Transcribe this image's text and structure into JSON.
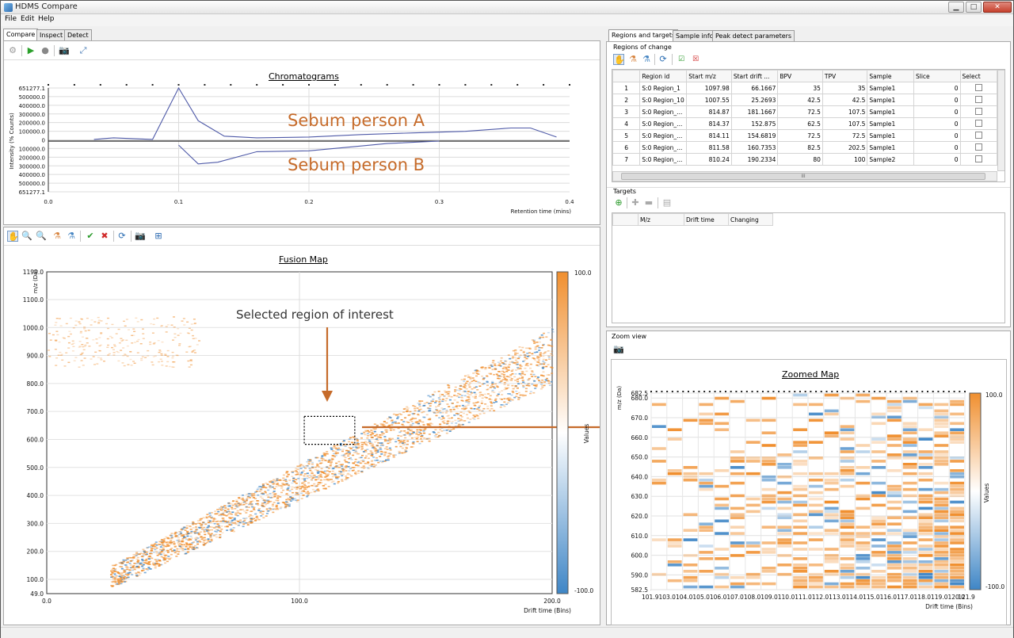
{
  "window": {
    "title": "HDMS Compare",
    "minimize": "▁",
    "maximize": "□",
    "close": "✕"
  },
  "menu": [
    "File",
    "Edit",
    "Help"
  ],
  "left_tabs": [
    "Compare",
    "Inspect",
    "Detect"
  ],
  "right_tabs": [
    "Regions and targets",
    "Sample info",
    "Peak detect parameters"
  ],
  "chromatogram": {
    "title": "Chromatograms",
    "ylabel": "Intensity (% Counts)",
    "xlabel": "Retention time (mins)",
    "y_ticks": [
      "651277.1",
      "500000.0",
      "400000.0",
      "300000.0",
      "200000.0",
      "100000.0",
      "0",
      "100000.0",
      "200000.0",
      "300000.0",
      "400000.0",
      "500000.0",
      "651277.1"
    ],
    "x_ticks": [
      "0.0",
      "0.1",
      "0.2",
      "0.3",
      "0.4"
    ],
    "label_a": "Sebum person A",
    "label_b": "Sebum person B"
  },
  "chart_data": [
    {
      "type": "line",
      "title": "Chromatograms",
      "xlabel": "Retention time (mins)",
      "ylabel": "Intensity (% Counts)",
      "xlim": [
        0.0,
        0.4
      ],
      "ylim": [
        -651277.1,
        651277.1
      ],
      "series": [
        {
          "name": "Sebum person A",
          "x": [
            0.035,
            0.05,
            0.065,
            0.08,
            0.1,
            0.115,
            0.135,
            0.16,
            0.2,
            0.24,
            0.28,
            0.32,
            0.355,
            0.37,
            0.39
          ],
          "y": [
            20000,
            40000,
            30000,
            20000,
            651277,
            250000,
            60000,
            40000,
            50000,
            80000,
            100000,
            120000,
            160000,
            160000,
            50000
          ]
        },
        {
          "name": "Sebum person B",
          "x": [
            0.1,
            0.115,
            0.13,
            0.16,
            0.2,
            0.24,
            0.26,
            0.3
          ],
          "y": [
            -50000,
            -280000,
            -260000,
            -130000,
            -120000,
            -60000,
            -30000,
            0
          ]
        }
      ]
    },
    {
      "type": "heatmap",
      "title": "Fusion Map",
      "xlabel": "Drift time (Bins)",
      "ylabel": "m/z (Da)",
      "xlim": [
        0,
        200
      ],
      "ylim": [
        49,
        1199
      ],
      "colorbar": {
        "label": "Values",
        "min": -100,
        "max": 100
      }
    },
    {
      "type": "heatmap",
      "title": "Zoomed Map",
      "xlabel": "Drift time (Bins)",
      "ylabel": "m/z (Da)",
      "xlim": [
        101.9,
        121.9
      ],
      "ylim": [
        582.5,
        682.5
      ],
      "colorbar": {
        "label": "Values",
        "min": -100,
        "max": 100
      }
    }
  ],
  "fusion_map": {
    "title": "Fusion Map",
    "ylabel": "m/z (Da)",
    "xlabel": "Drift time (Bins)",
    "y_ticks": [
      "1199.0",
      "1100.0",
      "1000.0",
      "900.0",
      "800.0",
      "700.0",
      "600.0",
      "500.0",
      "400.0",
      "300.0",
      "200.0",
      "100.0",
      "49.0"
    ],
    "x_ticks": [
      "0.0",
      "100.0",
      "200.0"
    ],
    "colorbar_max": "100.0",
    "colorbar_min": "-100.0",
    "colorbar_label": "Values",
    "annotation": "Selected region of interest"
  },
  "regions": {
    "section_title": "Regions of change",
    "columns": [
      "",
      "Region id",
      "Start m/z",
      "Start drift ...",
      "BPV",
      "TPV",
      "Sample",
      "Slice",
      "Select"
    ],
    "rows": [
      [
        "1",
        "S:0 Region_1",
        "1097.98",
        "66.1667",
        "35",
        "35",
        "Sample1",
        "0"
      ],
      [
        "2",
        "S:0 Region_10",
        "1007.55",
        "25.2693",
        "42.5",
        "42.5",
        "Sample1",
        "0"
      ],
      [
        "3",
        "S:0 Region_...",
        "814.87",
        "181.1667",
        "72.5",
        "107.5",
        "Sample1",
        "0"
      ],
      [
        "4",
        "S:0 Region_...",
        "814.37",
        "152.875",
        "62.5",
        "107.5",
        "Sample1",
        "0"
      ],
      [
        "5",
        "S:0 Region_...",
        "814.11",
        "154.6819",
        "72.5",
        "72.5",
        "Sample1",
        "0"
      ],
      [
        "6",
        "S:0 Region_...",
        "811.58",
        "160.7353",
        "82.5",
        "202.5",
        "Sample1",
        "0"
      ],
      [
        "7",
        "S:0 Region_...",
        "810.24",
        "190.2334",
        "80",
        "100",
        "Sample2",
        "0"
      ]
    ],
    "hscroll_marker": "III"
  },
  "targets": {
    "section_title": "Targets",
    "columns": [
      "",
      "M/z",
      "Drift time",
      "Changing"
    ]
  },
  "zoom": {
    "section_title": "Zoom view",
    "title": "Zoomed Map",
    "ylabel": "m/z (Da)",
    "xlabel": "Drift time (Bins)",
    "y_ticks": [
      "682.5",
      "680.0",
      "670.0",
      "660.0",
      "650.0",
      "640.0",
      "630.0",
      "620.0",
      "610.0",
      "600.0",
      "590.0",
      "582.5"
    ],
    "x_ticks": "101.9103.0104.0105.0106.0107.0108.0109.0110.0111.0112.0113.0114.0115.0116.0117.0118.0119.0120.0",
    "x_end": "121.9",
    "colorbar_max": "100.0",
    "colorbar_min": "-100.0",
    "colorbar_label": "Values"
  },
  "colors": {
    "orange": "#f08f2f",
    "blue": "#3f86c6",
    "annotation": "#c66b2a"
  }
}
